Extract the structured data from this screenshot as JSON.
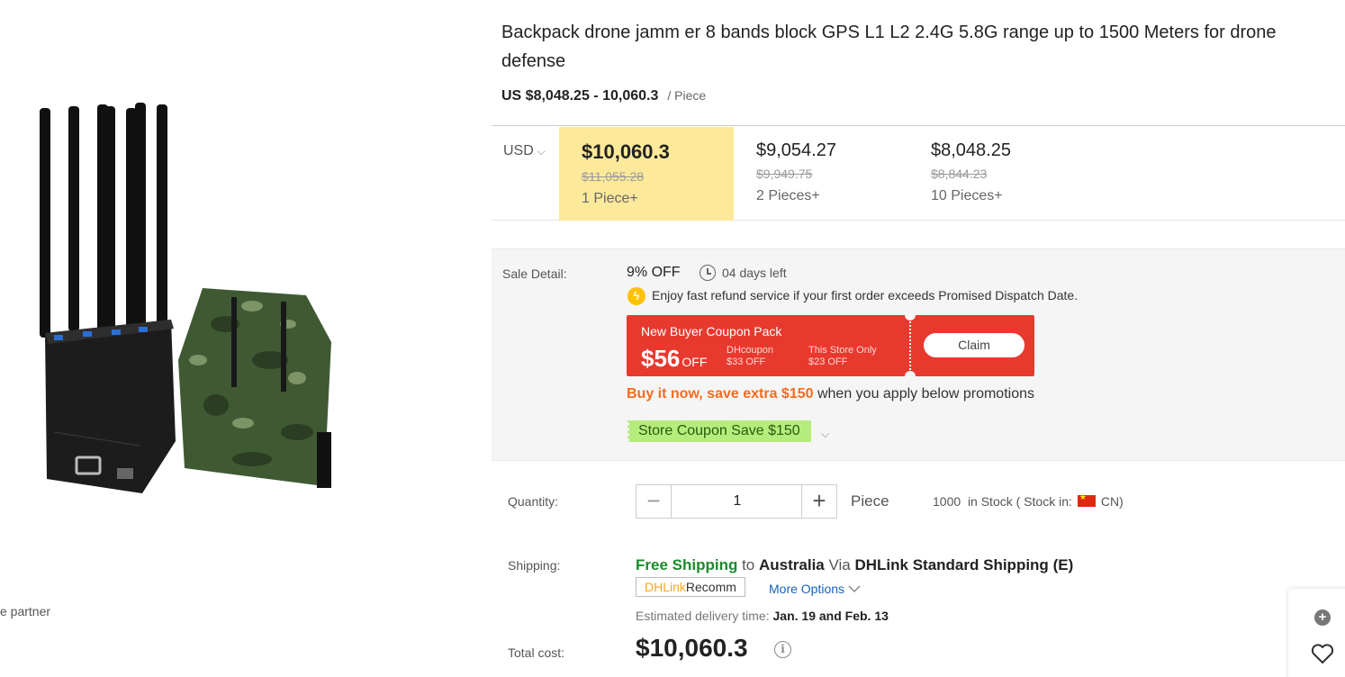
{
  "product": {
    "title": "Backpack drone jamm er 8 bands block GPS L1 L2 2.4G 5.8G range up to 1500 Meters for drone defense",
    "price_range": "US $8,048.25 - 10,060.3",
    "price_unit": "/ Piece",
    "partner_text": "e partner"
  },
  "tiers": {
    "currency": "USD",
    "items": [
      {
        "price": "$10,060.3",
        "original": "$11,055.28",
        "qty": "1 Piece+"
      },
      {
        "price": "$9,054.27",
        "original": "$9,949.75",
        "qty": "2 Pieces+"
      },
      {
        "price": "$8,048.25",
        "original": "$8,844.23",
        "qty": "10 Pieces+"
      }
    ]
  },
  "sale": {
    "label": "Sale Detail:",
    "discount": "9% OFF",
    "days_left": "04 days left",
    "refund_text": "Enjoy fast refund service if your first order exceeds Promised Dispatch Date.",
    "coupon": {
      "title": "New Buyer Coupon Pack",
      "amount": "$56",
      "off": "OFF",
      "dh_label": "DHcoupon",
      "dh_value": "$33 OFF",
      "store_label": "This Store Only",
      "store_value": "$23 OFF",
      "claim": "Claim"
    },
    "promo_prefix": "Buy it now, save extra",
    "promo_amount": "$150",
    "promo_suffix": "when you apply below promotions",
    "store_coupon": "Store Coupon Save $150"
  },
  "quantity": {
    "label": "Quantity:",
    "value": "1",
    "minus": "−",
    "plus": "+",
    "unit": "Piece",
    "stock_count": "1000",
    "stock_text": "in Stock ( Stock in:",
    "stock_country": "CN)"
  },
  "shipping": {
    "label": "Shipping:",
    "free": "Free Shipping",
    "to": "to",
    "country": "Australia",
    "via": "Via",
    "method": "DHLink Standard Shipping",
    "code": "(E)",
    "tag_orange": "DHLink",
    "tag_rest": "Recomm",
    "more_options": "More Options",
    "delivery_label": "Estimated delivery time:",
    "date_from": "Jan. 19",
    "and": "and",
    "date_to": "Feb. 13"
  },
  "total": {
    "label": "Total cost:",
    "value": "$10,060.3",
    "info": "i"
  },
  "colors": {
    "coupon_red": "#e8392f",
    "tier_highlight": "#fde99a",
    "promo_orange": "#f76b1c",
    "free_green": "#1b8a2c",
    "store_coupon_green": "#b6ec7c",
    "link_blue": "#1c62b9"
  },
  "icons": {
    "clock": "clock-icon",
    "bolt": "lightning-icon",
    "flag": "cn-flag-icon",
    "info": "info-icon",
    "add": "plus-circle-icon",
    "favorite": "heart-icon"
  }
}
